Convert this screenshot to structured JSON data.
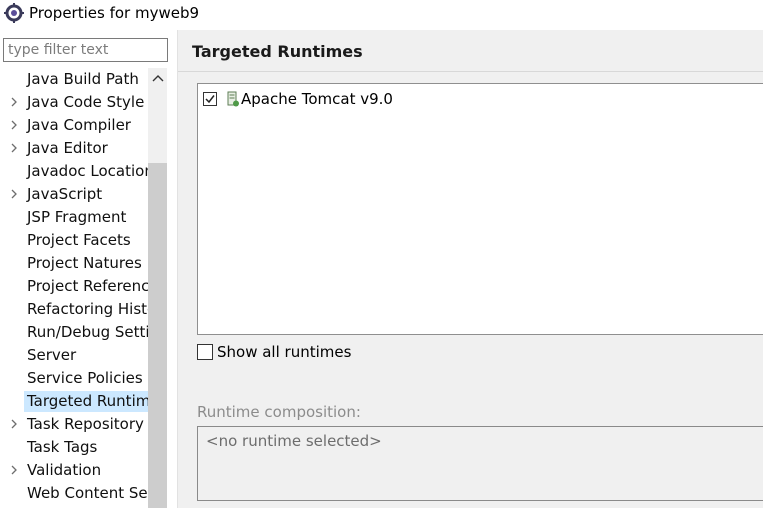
{
  "window": {
    "title": "Properties for myweb9",
    "icon": "eclipse-gear-icon"
  },
  "filter": {
    "placeholder": "type filter text",
    "value": ""
  },
  "tree": {
    "items": [
      {
        "label": "Java Build Path",
        "expandable": false,
        "selected": false
      },
      {
        "label": "Java Code Style",
        "expandable": true,
        "selected": false
      },
      {
        "label": "Java Compiler",
        "expandable": true,
        "selected": false
      },
      {
        "label": "Java Editor",
        "expandable": true,
        "selected": false
      },
      {
        "label": "Javadoc Location",
        "expandable": false,
        "selected": false
      },
      {
        "label": "JavaScript",
        "expandable": true,
        "selected": false
      },
      {
        "label": "JSP Fragment",
        "expandable": false,
        "selected": false
      },
      {
        "label": "Project Facets",
        "expandable": false,
        "selected": false
      },
      {
        "label": "Project Natures",
        "expandable": false,
        "selected": false
      },
      {
        "label": "Project References",
        "expandable": false,
        "selected": false
      },
      {
        "label": "Refactoring History",
        "expandable": false,
        "selected": false
      },
      {
        "label": "Run/Debug Settings",
        "expandable": false,
        "selected": false
      },
      {
        "label": "Server",
        "expandable": false,
        "selected": false
      },
      {
        "label": "Service Policies",
        "expandable": false,
        "selected": false
      },
      {
        "label": "Targeted Runtimes",
        "expandable": false,
        "selected": true
      },
      {
        "label": "Task Repository",
        "expandable": true,
        "selected": false
      },
      {
        "label": "Task Tags",
        "expandable": false,
        "selected": false
      },
      {
        "label": "Validation",
        "expandable": true,
        "selected": false
      },
      {
        "label": "Web Content Settings",
        "expandable": false,
        "selected": false
      }
    ]
  },
  "page": {
    "title": "Targeted Runtimes",
    "runtimes": [
      {
        "label": "Apache Tomcat v9.0",
        "checked": true,
        "icon": "tomcat-server-icon"
      }
    ],
    "show_all_label": "Show all runtimes",
    "show_all_checked": false,
    "composition_label": "Runtime composition:",
    "composition_value": "<no runtime selected>"
  },
  "colors": {
    "selection": "#cce8ff",
    "panel_bg": "#f0f0f0",
    "scroll_thumb": "#cdcdcd"
  }
}
